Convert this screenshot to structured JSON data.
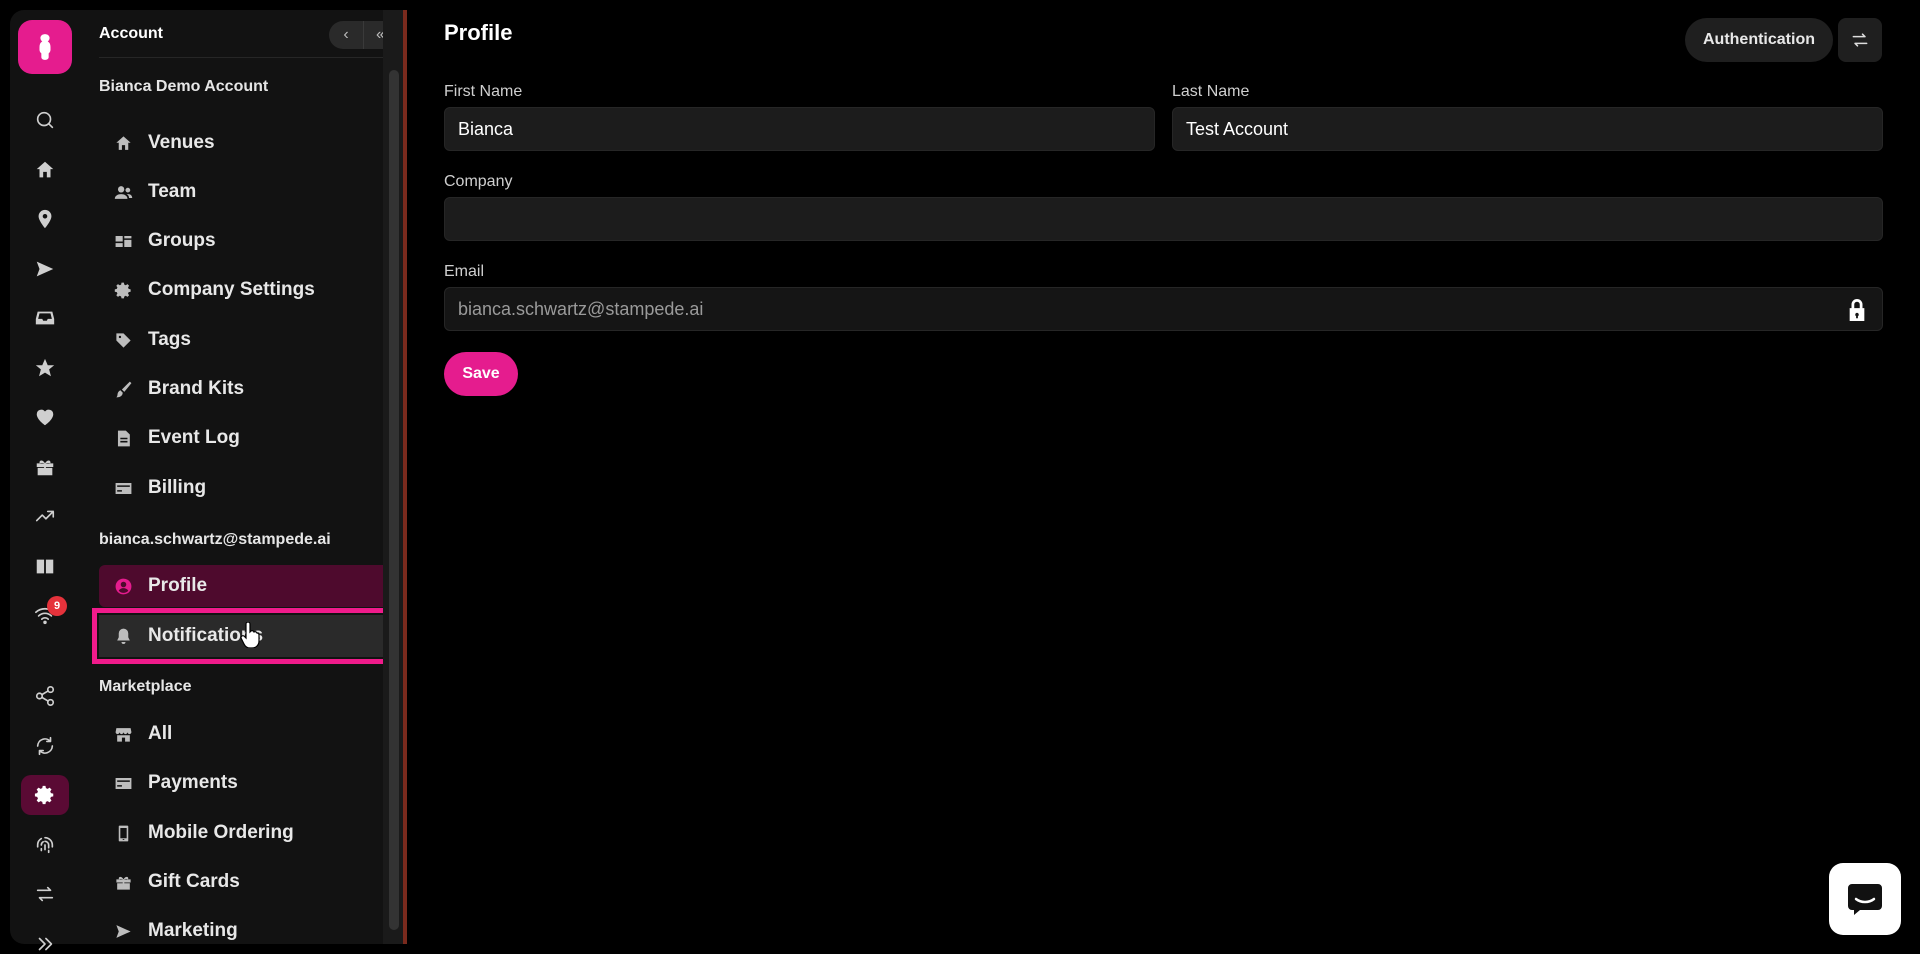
{
  "rail": {
    "badge_count": "9"
  },
  "sidebar": {
    "header_title": "Account",
    "sections": [
      {
        "label": "Bianca Demo Account",
        "items": [
          {
            "label": "Venues",
            "icon": "home-icon"
          },
          {
            "label": "Team",
            "icon": "users-icon"
          },
          {
            "label": "Groups",
            "icon": "groups-icon"
          },
          {
            "label": "Company Settings",
            "icon": "gear-icon"
          },
          {
            "label": "Tags",
            "icon": "tag-icon"
          },
          {
            "label": "Brand Kits",
            "icon": "brush-icon"
          },
          {
            "label": "Event Log",
            "icon": "document-icon"
          },
          {
            "label": "Billing",
            "icon": "card-icon"
          }
        ]
      },
      {
        "label": "bianca.schwartz@stampede.ai",
        "items": [
          {
            "label": "Profile",
            "icon": "user-circle-icon",
            "active": true
          },
          {
            "label": "Notifications",
            "icon": "bell-icon",
            "focused": true
          }
        ]
      },
      {
        "label": "Marketplace",
        "items": [
          {
            "label": "All",
            "icon": "store-icon"
          },
          {
            "label": "Payments",
            "icon": "card-icon"
          },
          {
            "label": "Mobile Ordering",
            "icon": "mobile-icon"
          },
          {
            "label": "Gift Cards",
            "icon": "gift-icon"
          },
          {
            "label": "Marketing",
            "icon": "send-icon"
          }
        ]
      }
    ]
  },
  "main": {
    "title": "Profile",
    "auth_button": "Authentication",
    "first_name_label": "First Name",
    "first_name_value": "Bianca",
    "last_name_label": "Last Name",
    "last_name_value": "Test Account",
    "company_label": "Company",
    "company_value": "",
    "email_label": "Email",
    "email_value": "bianca.schwartz@stampede.ai",
    "save_label": "Save"
  },
  "colors": {
    "accent": "#e51c8e",
    "background": "#000000",
    "panel": "#121212"
  }
}
